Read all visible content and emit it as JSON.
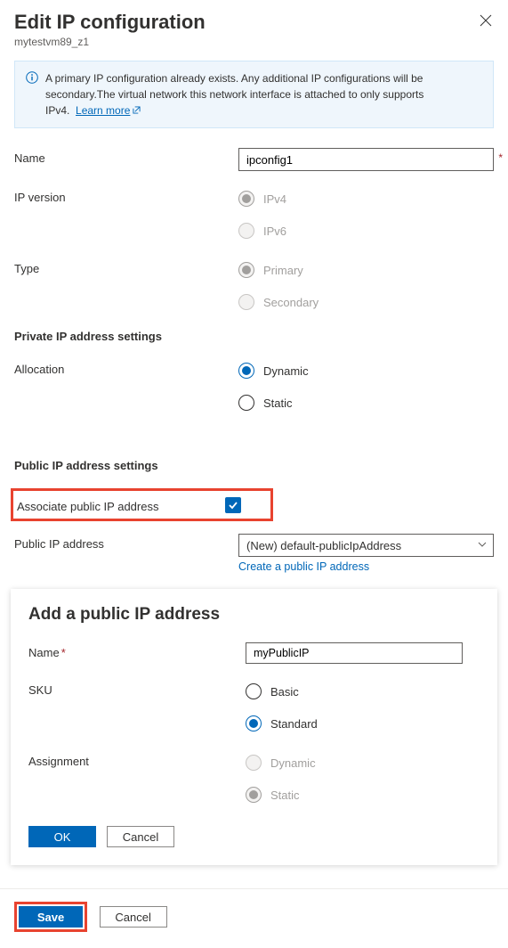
{
  "header": {
    "title": "Edit IP configuration",
    "subtitle": "mytestvm89_z1"
  },
  "infoBox": {
    "text": "A primary IP configuration already exists. Any additional IP configurations will be secondary.The virtual network this network interface is attached to only supports IPv4.",
    "linkText": "Learn more"
  },
  "fields": {
    "name": {
      "label": "Name",
      "value": "ipconfig1"
    },
    "ipVersion": {
      "label": "IP version",
      "optIpv4": "IPv4",
      "optIpv6": "IPv6"
    },
    "type": {
      "label": "Type",
      "optPrimary": "Primary",
      "optSecondary": "Secondary"
    },
    "privateHeader": "Private IP address settings",
    "allocation": {
      "label": "Allocation",
      "optDynamic": "Dynamic",
      "optStatic": "Static"
    },
    "publicHeader": "Public IP address settings",
    "associate": {
      "label": "Associate public IP address"
    },
    "publicIp": {
      "label": "Public IP address",
      "selected": "(New) default-publicIpAddress",
      "createLink": "Create a public IP address"
    }
  },
  "popup": {
    "title": "Add a public IP address",
    "name": {
      "label": "Name",
      "value": "myPublicIP"
    },
    "sku": {
      "label": "SKU",
      "optBasic": "Basic",
      "optStandard": "Standard"
    },
    "assignment": {
      "label": "Assignment",
      "optDynamic": "Dynamic",
      "optStatic": "Static"
    },
    "buttons": {
      "ok": "OK",
      "cancel": "Cancel"
    }
  },
  "footer": {
    "save": "Save",
    "cancel": "Cancel"
  }
}
